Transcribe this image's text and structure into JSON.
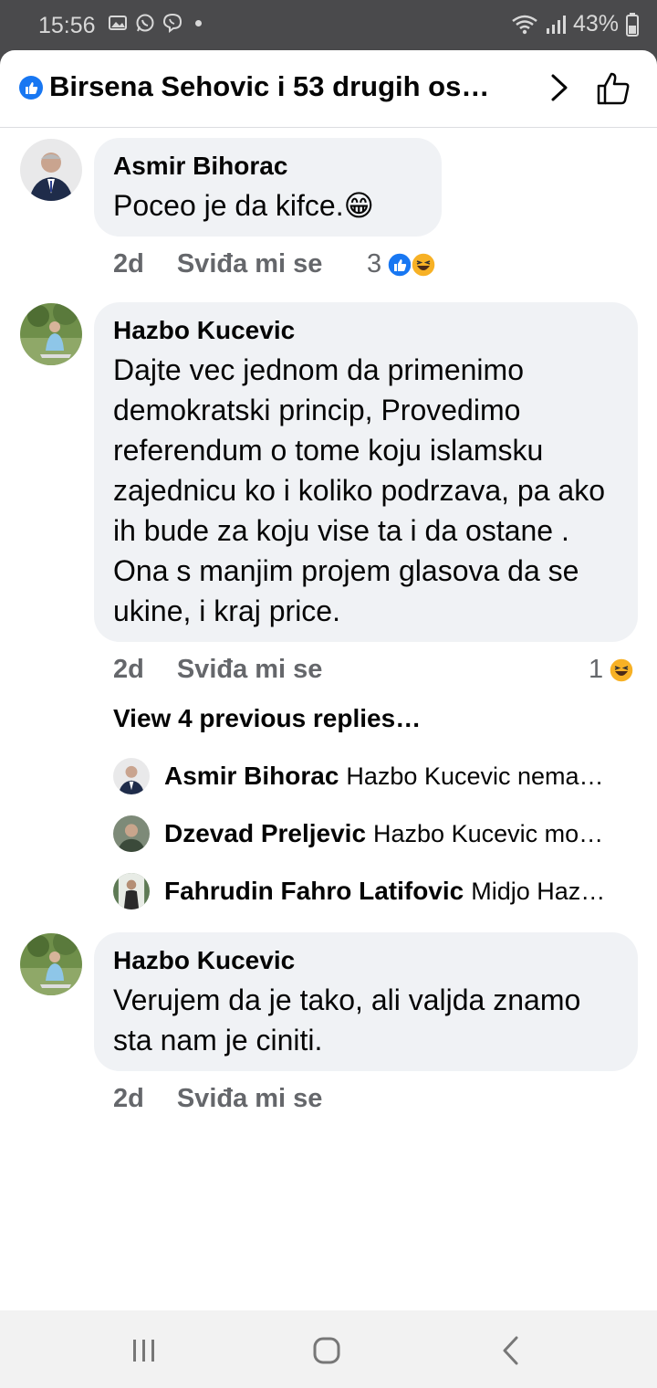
{
  "status_bar": {
    "time": "15:56",
    "battery": "43%",
    "icons": [
      "gallery-icon",
      "whatsapp-icon",
      "viber-icon",
      "wifi-icon",
      "signal-icon",
      "battery-icon"
    ]
  },
  "header": {
    "title": "Birsena Sehovic i 53 drugih os…",
    "icons": [
      "like-reaction-icon",
      "chevron-right-icon",
      "thumbs-up-outline-icon"
    ]
  },
  "comments": [
    {
      "author": "Asmir Bihorac",
      "text": "Poceo je da kifce.😁",
      "time": "2d",
      "like_label": "Sviđa mi se",
      "reaction_count": "3",
      "reactions": [
        "like",
        "haha"
      ]
    },
    {
      "author": "Hazbo Kucevic",
      "text": "Dajte vec jednom da primenimo demokratski princip, Provedimo referendum o tome koju islamsku zajednicu ko i koliko podrzava, pa ako ih bude za koju vise ta i da ostane . Ona s manjim projem glasova da se ukine, i kraj price.",
      "time": "2d",
      "like_label": "Sviđa mi se",
      "reaction_count": "1",
      "reactions": [
        "haha"
      ],
      "view_previous": "View 4 previous replies…",
      "replies": [
        {
          "author": "Asmir Bihorac",
          "text": "Hazbo Kucevic nema…"
        },
        {
          "author": "Dzevad Preljevic",
          "text": "Hazbo Kucevic mo…"
        },
        {
          "author": "Fahrudin Fahro Latifovic",
          "text": "Midjo Haz…"
        }
      ]
    },
    {
      "author": "Hazbo Kucevic",
      "text": "Verujem da je tako, ali valjda znamo sta nam je ciniti.",
      "time": "2d",
      "like_label": "Sviđa mi se"
    }
  ],
  "colors": {
    "facebook_blue": "#1877f2",
    "bubble_bg": "#f0f2f5",
    "meta_gray": "#65676b",
    "haha_yellow": "#f7b125"
  },
  "nav_bar": {
    "icons": [
      "recent-apps-icon",
      "home-icon",
      "back-icon"
    ]
  }
}
